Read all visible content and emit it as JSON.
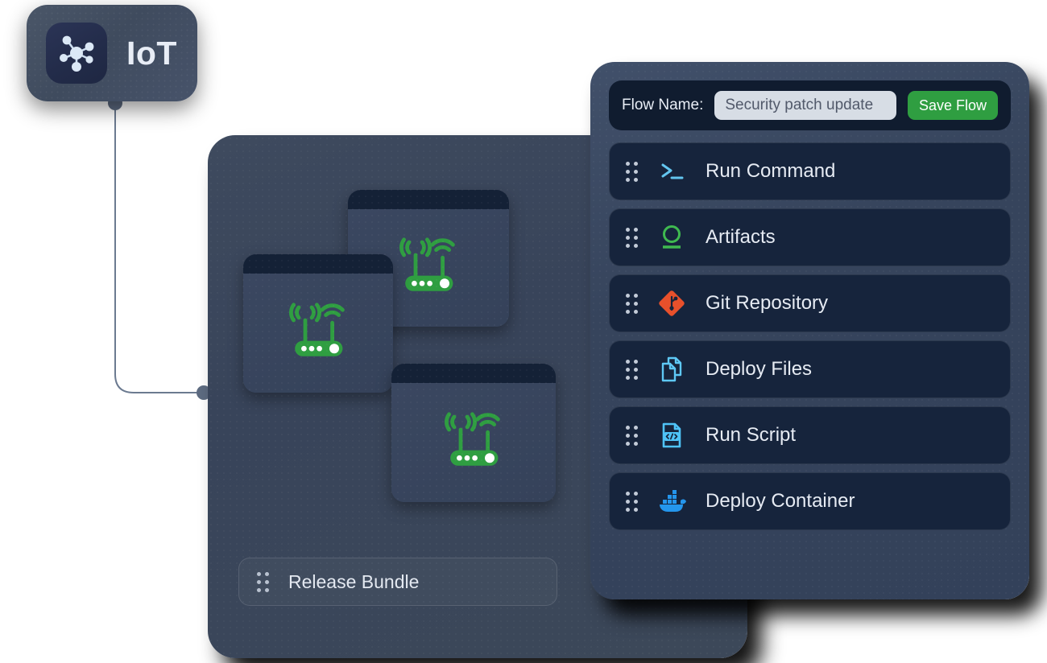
{
  "badge": {
    "label": "IoT",
    "icon": "network-hub-icon"
  },
  "flow_panel": {
    "header": {
      "name_label": "Flow Name:",
      "name_value": "Security patch update",
      "name_placeholder": "Security patch update",
      "save_label": "Save Flow",
      "save_color": "#2f9e41"
    },
    "items": [
      {
        "label": "Run Command",
        "icon": "terminal-prompt-icon",
        "color": "#63c6f0"
      },
      {
        "label": "Artifacts",
        "icon": "artifactory-ring-icon",
        "color": "#3fb950"
      },
      {
        "label": "Git Repository",
        "icon": "git-logo-icon",
        "color": "#e8502b"
      },
      {
        "label": "Deploy Files",
        "icon": "copy-files-icon",
        "color": "#5ec8f5"
      },
      {
        "label": "Run Script",
        "icon": "code-file-icon",
        "color": "#4fc3f7"
      },
      {
        "label": "Deploy Container",
        "icon": "docker-whale-icon",
        "color": "#2496ed"
      }
    ]
  },
  "devices_panel": {
    "release_bundle_label": "Release Bundle",
    "device_icon": "wifi-router-icon",
    "device_color": "#2f9e41",
    "devices": [
      {
        "name": "device-card-top"
      },
      {
        "name": "device-card-left"
      },
      {
        "name": "device-card-bottom"
      }
    ]
  },
  "connector": {
    "line_color": "#6b7a90",
    "node_color": "#5d6b81"
  }
}
